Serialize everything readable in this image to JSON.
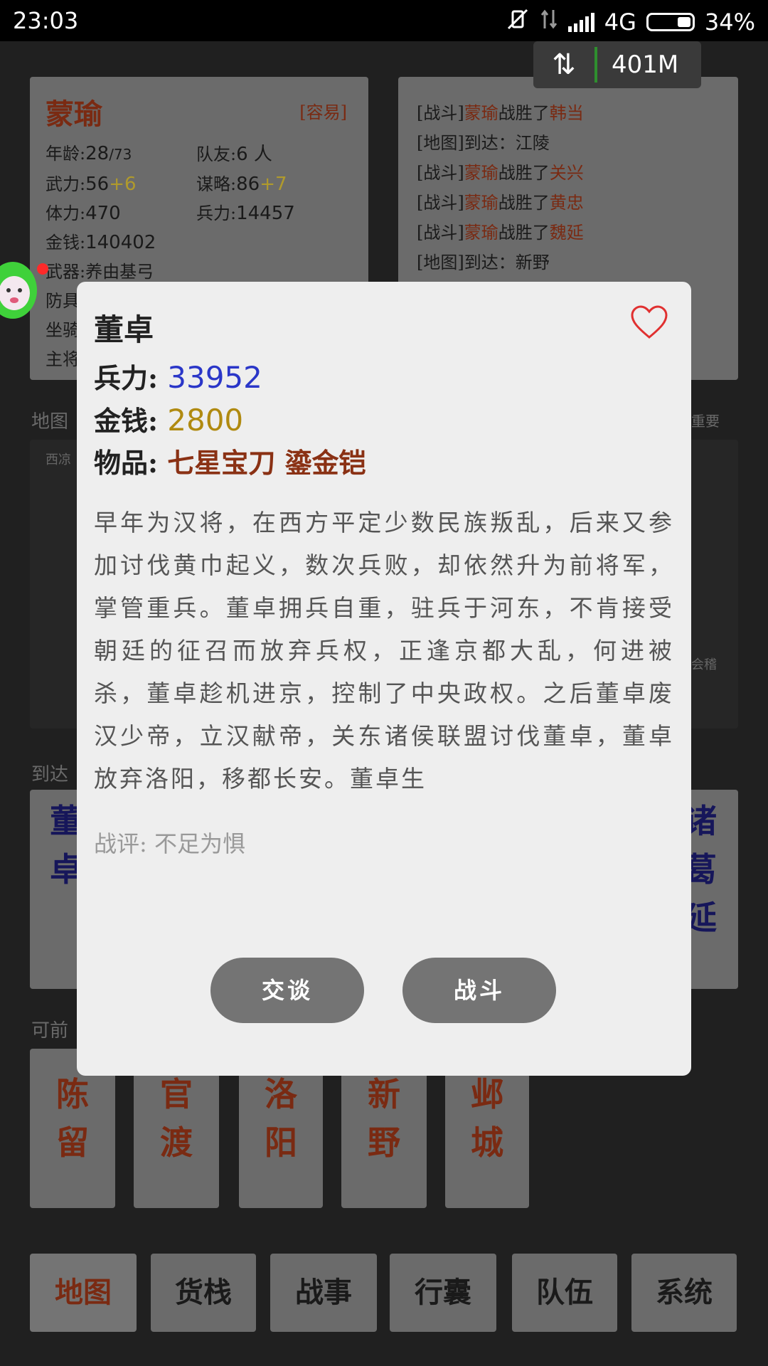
{
  "status_bar": {
    "time": "23:03",
    "network": "4G",
    "battery_percent": "34%",
    "battery_level": 0.34
  },
  "net_speed": {
    "value": "401M"
  },
  "character": {
    "name": "蒙瑜",
    "difficulty": "[容易]",
    "age_label": "年龄:",
    "age_value": "28",
    "age_max": "/73",
    "teammates_label": "队友:",
    "teammates_value": "6 人",
    "force_label": "武力:",
    "force_value": "56",
    "force_bonus": "+6",
    "strategy_label": "谋略:",
    "strategy_value": "86",
    "strategy_bonus": "+7",
    "stamina_label": "体力:",
    "stamina_value": "470",
    "troops_label": "兵力:",
    "troops_value": "14457",
    "money_label": "金钱:",
    "money_value": "140402",
    "weapon_label": "武器:",
    "weapon_value": "养由基弓",
    "armor_label_partial": "防具",
    "mount_label_partial": "坐骑",
    "general_label_partial": "主将"
  },
  "battle_log": [
    {
      "tag": "[战斗]",
      "actor": "蒙瑜",
      "verb": "战胜了",
      "target": "韩当"
    },
    {
      "tag": "[地图]",
      "actor": "",
      "verb": "到达：江陵",
      "target": ""
    },
    {
      "tag": "[战斗]",
      "actor": "蒙瑜",
      "verb": "战胜了",
      "target": "关兴"
    },
    {
      "tag": "[战斗]",
      "actor": "蒙瑜",
      "verb": "战胜了",
      "target": "黄忠"
    },
    {
      "tag": "[战斗]",
      "actor": "蒙瑜",
      "verb": "战胜了",
      "target": "魏延"
    },
    {
      "tag": "[地图]",
      "actor": "",
      "verb": "到达：新野",
      "target": ""
    }
  ],
  "sections": {
    "map_label": "地图",
    "important_label": "重要",
    "arrive_label": "到达",
    "can_go_label": "可前"
  },
  "map": {
    "town_left": "西凉",
    "town_right": "会稽"
  },
  "arrived_generals": {
    "left_partial": "董\n卓",
    "right_partial": "诸\n葛\n延"
  },
  "destinations": [
    {
      "label": "陈\n留"
    },
    {
      "label": "官\n渡"
    },
    {
      "label": "洛\n阳"
    },
    {
      "label": "新\n野"
    },
    {
      "label": "邺\n城"
    }
  ],
  "bottom_tabs": [
    {
      "label": "地图",
      "active": true
    },
    {
      "label": "货栈",
      "active": false
    },
    {
      "label": "战事",
      "active": false
    },
    {
      "label": "行囊",
      "active": false
    },
    {
      "label": "队伍",
      "active": false
    },
    {
      "label": "系统",
      "active": false
    }
  ],
  "modal": {
    "name": "董卓",
    "troops_label": "兵力:",
    "troops_value": "33952",
    "money_label": "金钱:",
    "money_value": "2800",
    "items_label": "物品:",
    "items_value": "七星宝刀 鎏金铠",
    "bio": "早年为汉将，在西方平定少数民族叛乱，后来又参加讨伐黄巾起义，数次兵败，却依然升为前将军，掌管重兵。董卓拥兵自重，驻兵于河东，不肯接受朝廷的征召而放弃兵权，正逢京都大乱，何进被杀，董卓趁机进京，控制了中央政权。之后董卓废汉少帝，立汉献帝，关东诸侯联盟讨伐董卓，董卓放弃洛阳，移都长安。董卓生",
    "comment": "战评: 不足为惧",
    "talk_button": "交谈",
    "fight_button": "战斗"
  },
  "colors": {
    "accent_red": "#7a2a12",
    "troops_blue": "#2a36c8",
    "money_gold": "#b08a10",
    "panel_gray": "#6b6b6b",
    "modal_bg": "#eeeeee"
  }
}
